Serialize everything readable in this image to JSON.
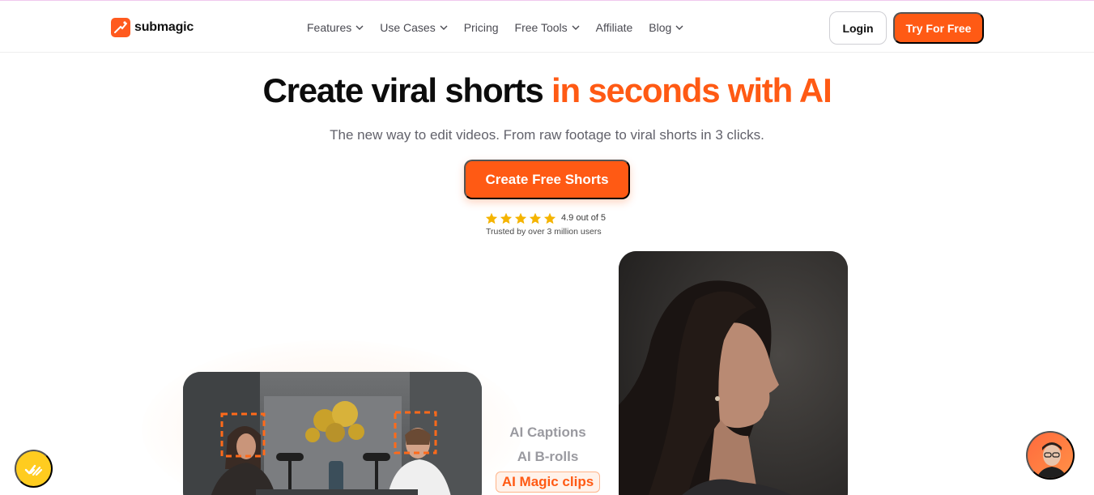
{
  "brand": {
    "name": "submagic",
    "accent": "#ff5a14"
  },
  "nav": {
    "items": [
      {
        "label": "Features",
        "dropdown": true
      },
      {
        "label": "Use Cases",
        "dropdown": true
      },
      {
        "label": "Pricing",
        "dropdown": false
      },
      {
        "label": "Free Tools",
        "dropdown": true
      },
      {
        "label": "Affiliate",
        "dropdown": false
      },
      {
        "label": "Blog",
        "dropdown": true
      }
    ],
    "login_label": "Login",
    "try_label": "Try For Free"
  },
  "hero": {
    "title_main": "Create viral shorts",
    "title_accent": "in seconds with AI",
    "subtitle": "The new way to edit videos. From raw footage to viral shorts in 3 clicks.",
    "cta_label": "Create Free Shorts",
    "rating": {
      "stars": 5,
      "score_text": "4.9 out of 5",
      "trust_text": "Trusted by over 3 million users",
      "star_color": "#f5b400"
    }
  },
  "features": {
    "items": [
      "AI Captions",
      "AI B-rolls",
      "AI Magic clips"
    ],
    "active": "AI Magic clips"
  },
  "widgets": {
    "left_fab_icon": "checklist-icon",
    "right_fab_icon": "support-avatar"
  }
}
